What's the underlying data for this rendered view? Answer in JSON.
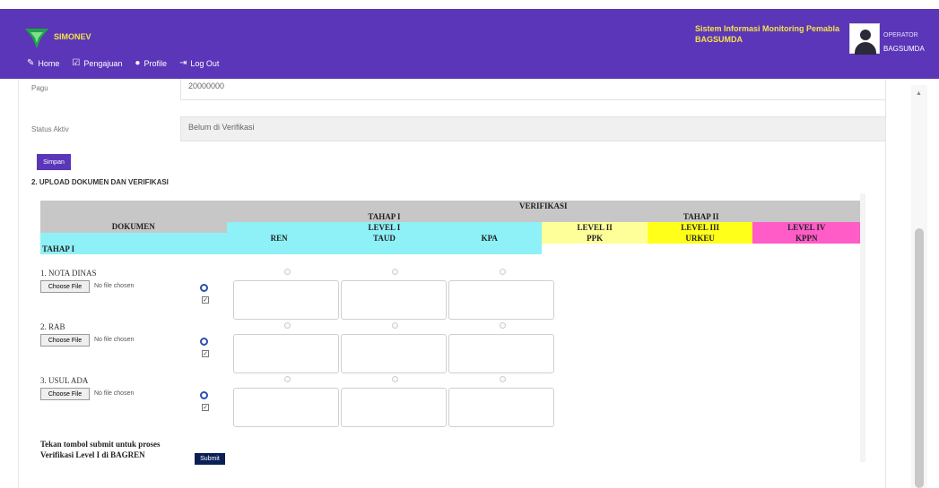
{
  "header": {
    "app_name": "SIMONEV",
    "system_title_line1": "Sistem Informasi Monitoring Pemabla",
    "system_title_line2": "BAGSUMDA",
    "user_role": "OPERATOR",
    "user_name": "BAGSUMDA",
    "nav": [
      {
        "label": "Home",
        "icon": "leaf-icon"
      },
      {
        "label": "Pengajuan",
        "icon": "clipboard-icon"
      },
      {
        "label": "Profile",
        "icon": "user-circle-icon"
      },
      {
        "label": "Log Out",
        "icon": "logout-icon"
      }
    ],
    "colors": {
      "header_bg": "#5b36b8",
      "title_color": "#f3e34a"
    }
  },
  "form": {
    "pagu_label": "Pagu",
    "pagu_value": "20000000",
    "status_label": "Status Aktiv",
    "status_value": "Belum di Verifikasi",
    "save_label": "Simpan"
  },
  "section_title": "2. UPLOAD DOKUMEN DAN VERIFIKASI",
  "table": {
    "dokumen_header": "DOKUMEN",
    "verifikasi_header": "VERIFIKASI",
    "tahap1": "TAHAP I",
    "tahap2": "TAHAP II",
    "level1": "LEVEL I",
    "taud": "TAUD",
    "ren": "REN",
    "kpa": "KPA",
    "level2": "LEVEL II",
    "ppk": "PPK",
    "level3": "LEVEL III",
    "urkeu": "URKEU",
    "level4": "LEVEL IV",
    "kppn": "KPPN",
    "tahap_row": "TAHAP I"
  },
  "documents": [
    {
      "label": "1. NOTA DINAS"
    },
    {
      "label": "2. RAB"
    },
    {
      "label": "3. USUL ADA"
    }
  ],
  "file_input": {
    "button": "Choose File",
    "status": "No file chosen"
  },
  "submit": {
    "text_line1": "Tekan tombol submit untuk proses",
    "text_line2": "Verifikasi Level I di BAGREN",
    "button": "Submit"
  }
}
